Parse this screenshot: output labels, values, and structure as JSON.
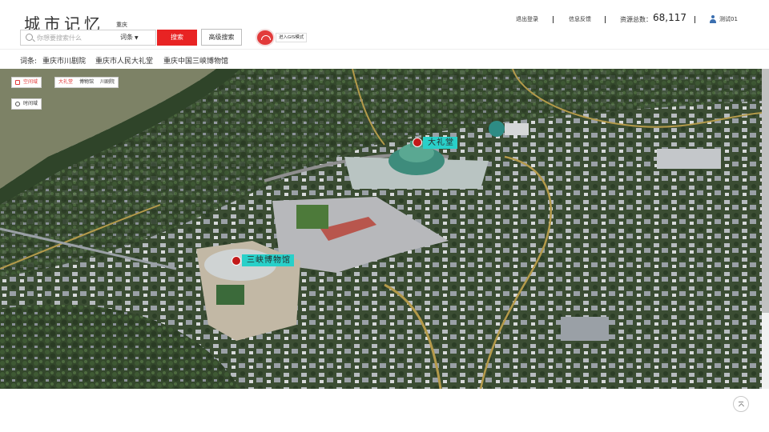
{
  "header": {
    "logo_text": "城市记忆",
    "city": "重庆",
    "search_placeholder": "你想要搜索什么",
    "search_type": "词条",
    "search_button": "搜索",
    "advanced_button": "高级搜索",
    "gis_button": "进入GIS模式",
    "logout": "退出登录",
    "feedback": "信息反馈",
    "resource_label": "资源总数：",
    "resource_count": "68,117",
    "user_name": "测试01"
  },
  "keywords": {
    "label": "词条:",
    "items": [
      "重庆市川剧院",
      "重庆市人民大礼堂",
      "重庆中国三峡博物馆"
    ]
  },
  "map": {
    "space_view": "空间域",
    "time_view": "时间域",
    "tags": [
      "大礼堂",
      "博物馆",
      "川剧院"
    ],
    "active_tag": "大礼堂",
    "pois": [
      {
        "label": "大礼堂"
      },
      {
        "label": "三峡博物馆"
      }
    ]
  },
  "colors": {
    "accent": "#e82323",
    "poi_label": "#29d0c9"
  }
}
